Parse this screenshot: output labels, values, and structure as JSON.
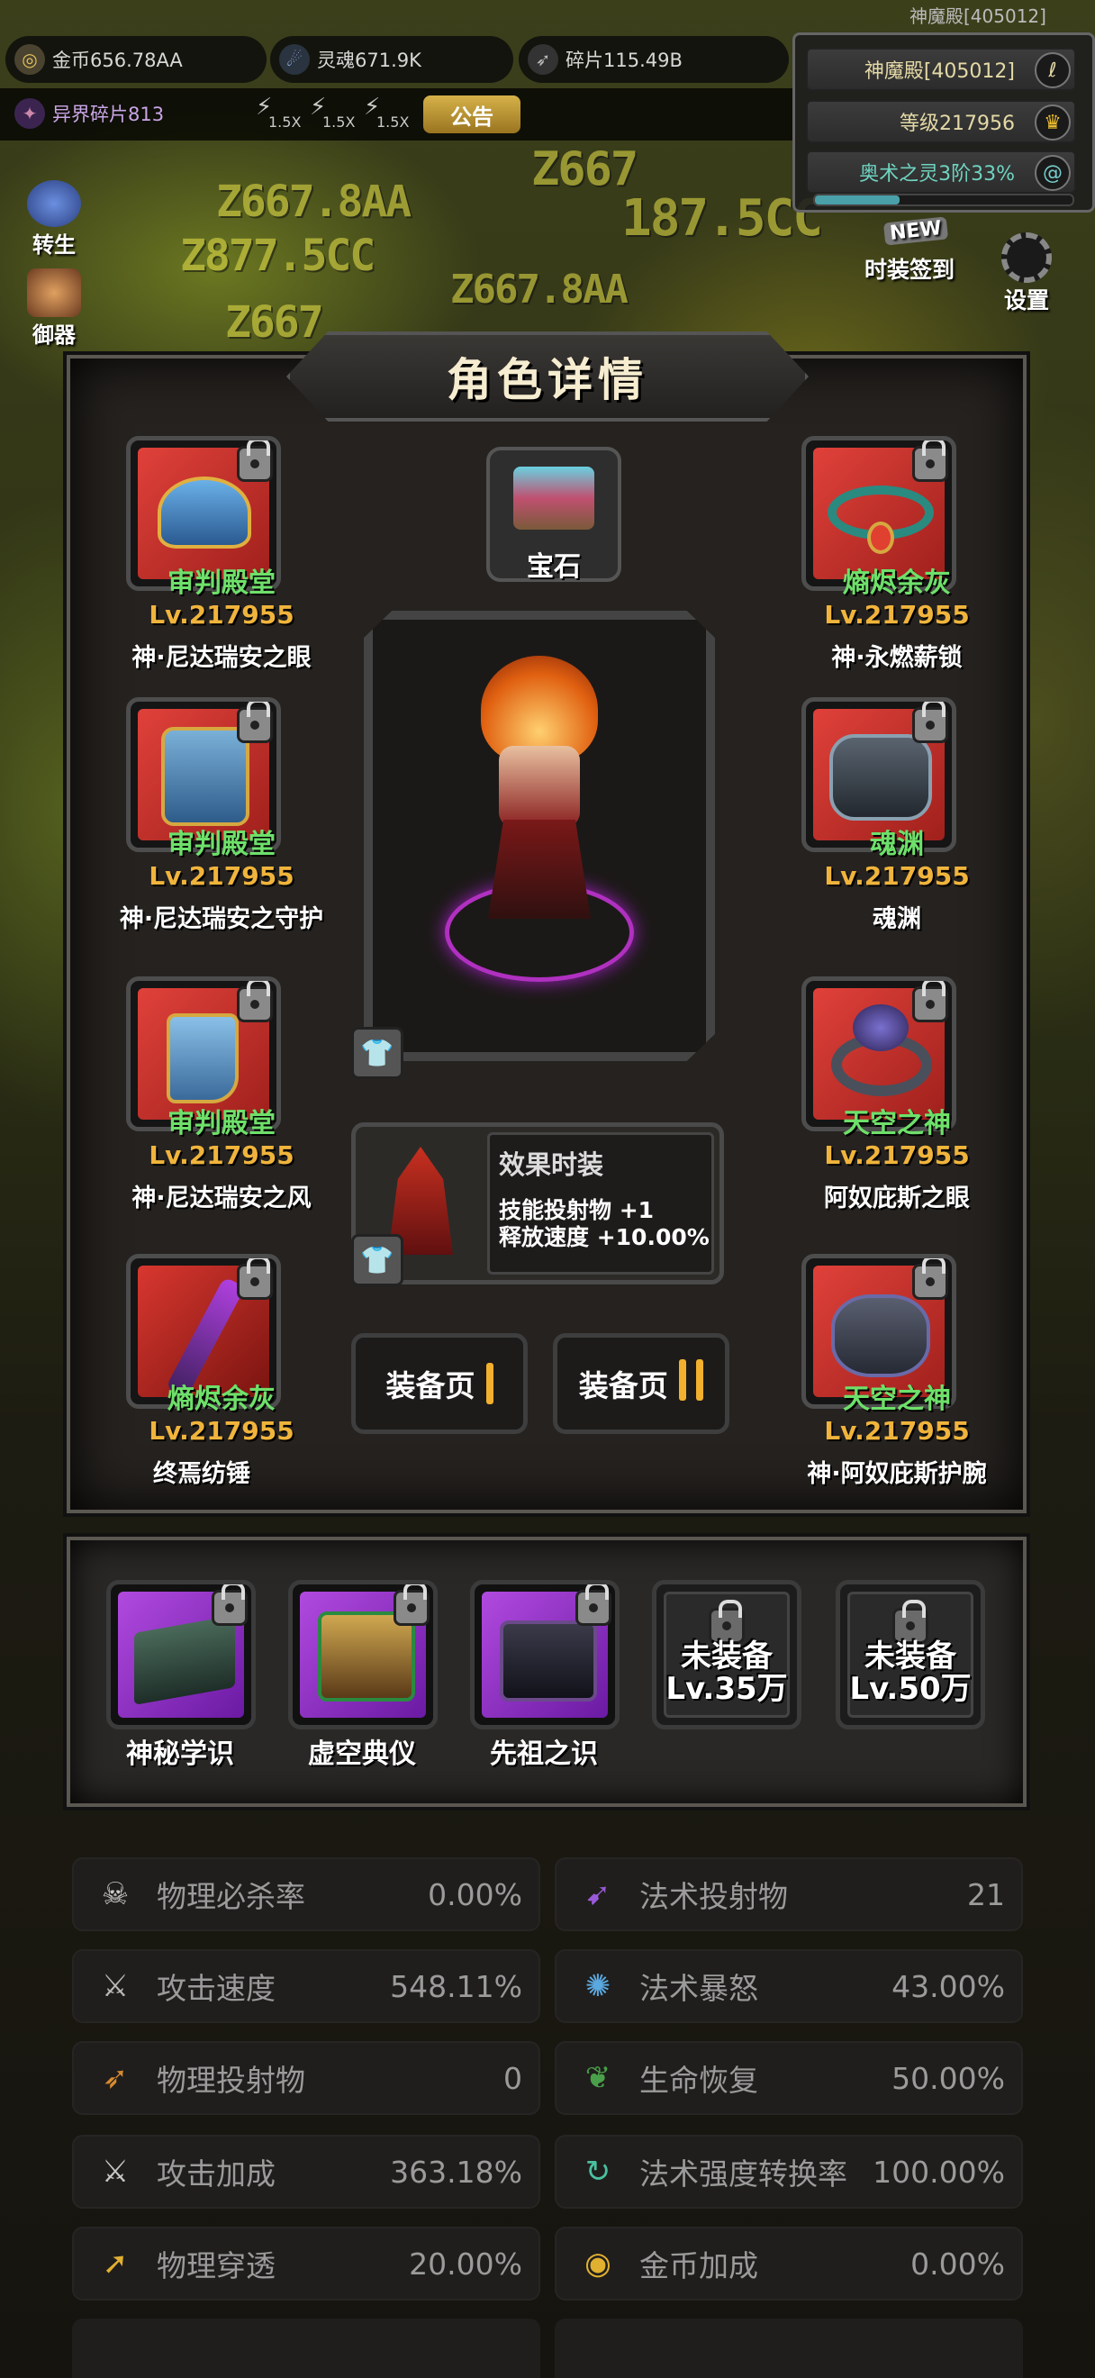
{
  "hud": {
    "gold": "金币656.78AA",
    "soul": "灵魂671.9K",
    "shard": "碎片115.49B",
    "otherworld_shard": "异界碎片813",
    "speed": [
      "1.5X",
      "1.5X",
      "1.5X"
    ],
    "notice": "公告",
    "top_right_label": "神魔殿[405012]"
  },
  "info_panel": {
    "hall": "神魔殿[405012]",
    "level": "等级217956",
    "arcane": "奥术之灵3阶33%"
  },
  "side_buttons": {
    "reincarnate": "转生",
    "weapon": "御器",
    "outfit_checkin": "时装签到",
    "settings": "设置",
    "new_badge": "NEW"
  },
  "bg_numbers": [
    "Z667",
    "Z667.8AA",
    "187.5CC",
    "Z877.5CC",
    "Z667.8AA",
    "Z667"
  ],
  "dialog": {
    "title": "角色详情",
    "gem_label": "宝石",
    "left_equipment": [
      {
        "set": "审判殿堂",
        "level": "Lv.217955",
        "name": "神·尼达瑞安之眼",
        "icon": "helmet-icon"
      },
      {
        "set": "审判殿堂",
        "level": "Lv.217955",
        "name": "神·尼达瑞安之守护",
        "icon": "armor-icon"
      },
      {
        "set": "审判殿堂",
        "level": "Lv.217955",
        "name": "神·尼达瑞安之风",
        "icon": "boots-icon"
      },
      {
        "set": "熵烬余灰",
        "level": "Lv.217955",
        "name": "终焉纺锤",
        "icon": "staff-icon"
      }
    ],
    "right_equipment": [
      {
        "set": "熵烬余灰",
        "level": "Lv.217955",
        "name": "神·永燃薪锁",
        "icon": "necklace-icon"
      },
      {
        "set": "魂渊",
        "level": "Lv.217955",
        "name": "魂渊",
        "icon": "gauntlet-icon"
      },
      {
        "set": "天空之神",
        "level": "Lv.217955",
        "name": "阿奴庇斯之眼",
        "icon": "ring-icon"
      },
      {
        "set": "天空之神",
        "level": "Lv.217955",
        "name": "神·阿奴庇斯护腕",
        "icon": "bracer-icon"
      }
    ],
    "effect_outfit": {
      "title": "效果时装",
      "line1": "技能投射物 +1",
      "line2": "释放速度 +10.00%"
    },
    "page1": "装备页",
    "page2": "装备页"
  },
  "artifacts": [
    {
      "name": "神秘学识",
      "icon": "tome-icon"
    },
    {
      "name": "虚空典仪",
      "icon": "ritual-book-icon"
    },
    {
      "name": "先祖之识",
      "icon": "ancestor-book-icon"
    },
    {
      "name": "未装备",
      "level": "Lv.35万"
    },
    {
      "name": "未装备",
      "level": "Lv.50万"
    }
  ],
  "stats": [
    {
      "label": "物理必杀率",
      "value": "0.00%",
      "icon": "skull-icon"
    },
    {
      "label": "法术投射物",
      "value": "21",
      "icon": "magic-bolt-icon"
    },
    {
      "label": "攻击速度",
      "value": "548.11%",
      "icon": "sword-speed-icon"
    },
    {
      "label": "法术暴怒",
      "value": "43.00%",
      "icon": "fury-icon"
    },
    {
      "label": "物理投射物",
      "value": "0",
      "icon": "arrow-icon"
    },
    {
      "label": "生命恢复",
      "value": "50.00%",
      "icon": "leaf-icon"
    },
    {
      "label": "攻击加成",
      "value": "363.18%",
      "icon": "crossed-swords-icon"
    },
    {
      "label": "法术强度转换率",
      "value": "100.00%",
      "icon": "spiral-icon"
    },
    {
      "label": "物理穿透",
      "value": "20.00%",
      "icon": "pierce-icon"
    },
    {
      "label": "金币加成",
      "value": "0.00%",
      "icon": "coin-icon"
    }
  ],
  "colors": {
    "set_green": "#6ee06a",
    "level_orange": "#f0b43c",
    "slot_red": "#d8372f",
    "artifact_purple": "#9b3cd6",
    "notice_gold": "#c9a23c"
  }
}
